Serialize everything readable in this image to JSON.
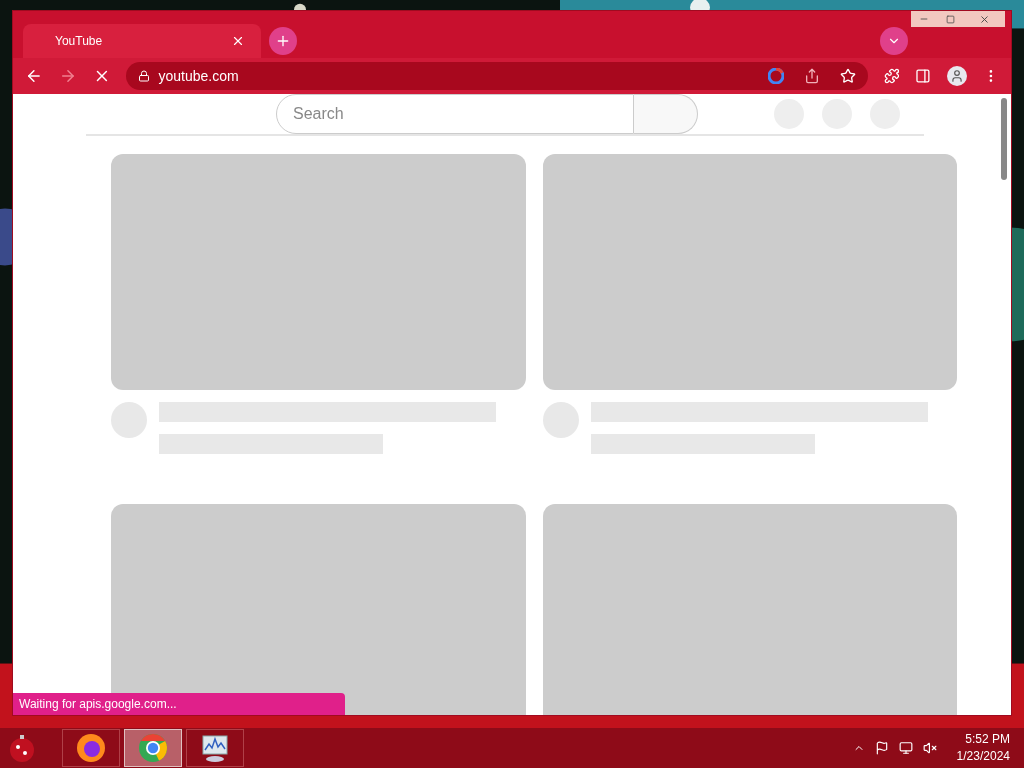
{
  "tabs": [
    {
      "title": "YouTube",
      "selected": true
    }
  ],
  "toolbar": {
    "address": "youtube.com",
    "loading": true,
    "forward_disabled": true
  },
  "search": {
    "placeholder": "Search"
  },
  "status_text": "Waiting for apis.google.com...",
  "taskbar": {
    "apps": [
      {
        "kind": "firefox",
        "selected": false
      },
      {
        "kind": "chrome",
        "selected": true
      },
      {
        "kind": "monitor",
        "selected": false
      }
    ],
    "time": "5:52 PM",
    "date": "1/23/2024"
  }
}
